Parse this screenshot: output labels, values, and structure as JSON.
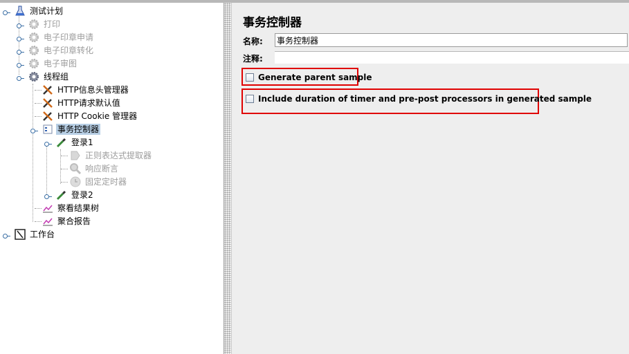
{
  "tree": {
    "root": {
      "label": "测试计划",
      "icon": "beaker-icon"
    },
    "items": [
      {
        "label": "打印",
        "icon": "gear-icon",
        "disabled": true
      },
      {
        "label": "电子印章申请",
        "icon": "gear-icon",
        "disabled": true
      },
      {
        "label": "电子印章转化",
        "icon": "gear-icon",
        "disabled": true
      },
      {
        "label": "电子审图",
        "icon": "gear-icon",
        "disabled": true
      },
      {
        "label": "线程组",
        "icon": "gear-icon",
        "disabled": false
      }
    ],
    "thread_group_children": [
      {
        "label": "HTTP信息头管理器",
        "icon": "wrench-icon"
      },
      {
        "label": "HTTP请求默认值",
        "icon": "wrench-icon"
      },
      {
        "label": "HTTP Cookie 管理器",
        "icon": "wrench-icon"
      },
      {
        "label": "事务控制器",
        "icon": "controller-icon",
        "selected": true
      }
    ],
    "login1": {
      "label": "登录1",
      "icon": "pipette-icon"
    },
    "login1_children": [
      {
        "label": "正则表达式提取器",
        "icon": "extractor-icon",
        "disabled": true
      },
      {
        "label": "响应断言",
        "icon": "magnifier-icon",
        "disabled": true
      },
      {
        "label": "固定定时器",
        "icon": "timer-icon",
        "disabled": true
      }
    ],
    "login2": {
      "label": "登录2",
      "icon": "pipette-icon"
    },
    "listeners": [
      {
        "label": "察看结果树",
        "icon": "graph-icon"
      },
      {
        "label": "聚合报告",
        "icon": "graph-icon"
      }
    ],
    "workbench": {
      "label": "工作台",
      "icon": "workbench-icon"
    }
  },
  "panel": {
    "title": "事务控制器",
    "name_label": "名称:",
    "name_value": "事务控制器",
    "comment_label": "注释:",
    "comment_value": "",
    "generate_parent_label": "Generate parent sample",
    "generate_parent_checked": false,
    "include_duration_label": "Include duration of timer and pre-post processors in generated sample",
    "include_duration_checked": false,
    "highlight_color": "#e00000"
  }
}
